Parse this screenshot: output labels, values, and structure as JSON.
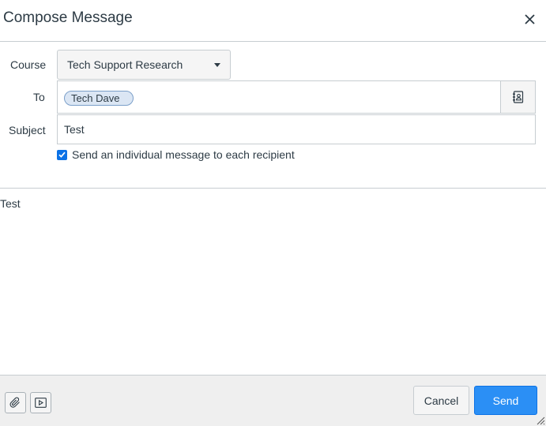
{
  "dialog": {
    "title": "Compose Message",
    "close_icon": "close-icon"
  },
  "form": {
    "course": {
      "label": "Course",
      "selected": "Tech Support Research"
    },
    "to": {
      "label": "To",
      "recipients": [
        "Tech Dave"
      ],
      "address_book_icon": "address-book-icon"
    },
    "subject": {
      "label": "Subject",
      "value": "Test"
    },
    "individual_message": {
      "label": "Send an individual message to each recipient",
      "checked": true
    }
  },
  "message": {
    "body": "Test"
  },
  "footer": {
    "attach_icon": "paperclip-icon",
    "media_icon": "media-icon",
    "cancel_label": "Cancel",
    "send_label": "Send"
  },
  "colors": {
    "primary": "#2b8ff5",
    "text": "#2d3b45",
    "border": "#c7cdd1",
    "footer_bg": "#efefef",
    "token_bg": "#dbe6f4"
  }
}
